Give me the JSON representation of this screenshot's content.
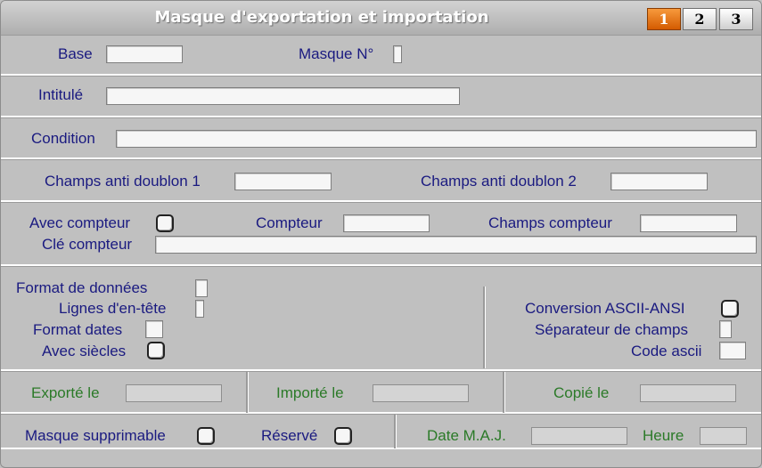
{
  "window": {
    "title": "Masque d'exportation et importation"
  },
  "tabs": [
    {
      "label": "1",
      "active": true
    },
    {
      "label": "2",
      "active": false
    },
    {
      "label": "3",
      "active": false
    }
  ],
  "labels": {
    "base": "Base",
    "masque_no": "Masque N°",
    "intitule": "Intitulé",
    "condition": "Condition",
    "champs_anti_doublon_1": "Champs anti doublon 1",
    "champs_anti_doublon_2": "Champs anti doublon 2",
    "avec_compteur": "Avec compteur",
    "compteur": "Compteur",
    "champs_compteur": "Champs compteur",
    "cle_compteur": "Clé compteur",
    "format_donnees": "Format de données",
    "lignes_entete": "Lignes d'en-tête",
    "format_dates": "Format dates",
    "avec_siecles": "Avec siècles",
    "conversion_ascii_ansi": "Conversion ASCII-ANSI",
    "separateur_champs": "Séparateur de champs",
    "code_ascii": "Code ascii",
    "exporte_le": "Exporté le",
    "importe_le": "Importé le",
    "copie_le": "Copié le",
    "masque_supprimable": "Masque supprimable",
    "reserve": "Réservé",
    "date_maj": "Date M.A.J.",
    "heure": "Heure"
  },
  "values": {
    "base": "",
    "masque_no": "",
    "intitule": "",
    "condition": "",
    "champs_anti_doublon_1": "",
    "champs_anti_doublon_2": "",
    "compteur": "",
    "champs_compteur": "",
    "cle_compteur": "",
    "format_donnees": "",
    "lignes_entete": "",
    "format_dates": "",
    "separateur_champs": "",
    "code_ascii": "",
    "exporte_le": "",
    "importe_le": "",
    "copie_le": "",
    "date_maj": "",
    "heure": ""
  },
  "checkboxes": {
    "avec_compteur": false,
    "avec_siecles": false,
    "conversion_ascii_ansi": false,
    "masque_supprimable": false,
    "reserve": false
  },
  "colors": {
    "label": "#1a1a80",
    "label_readonly": "#2b7a28",
    "tab_active": "#e06a0c",
    "background": "#c0c0c0"
  }
}
